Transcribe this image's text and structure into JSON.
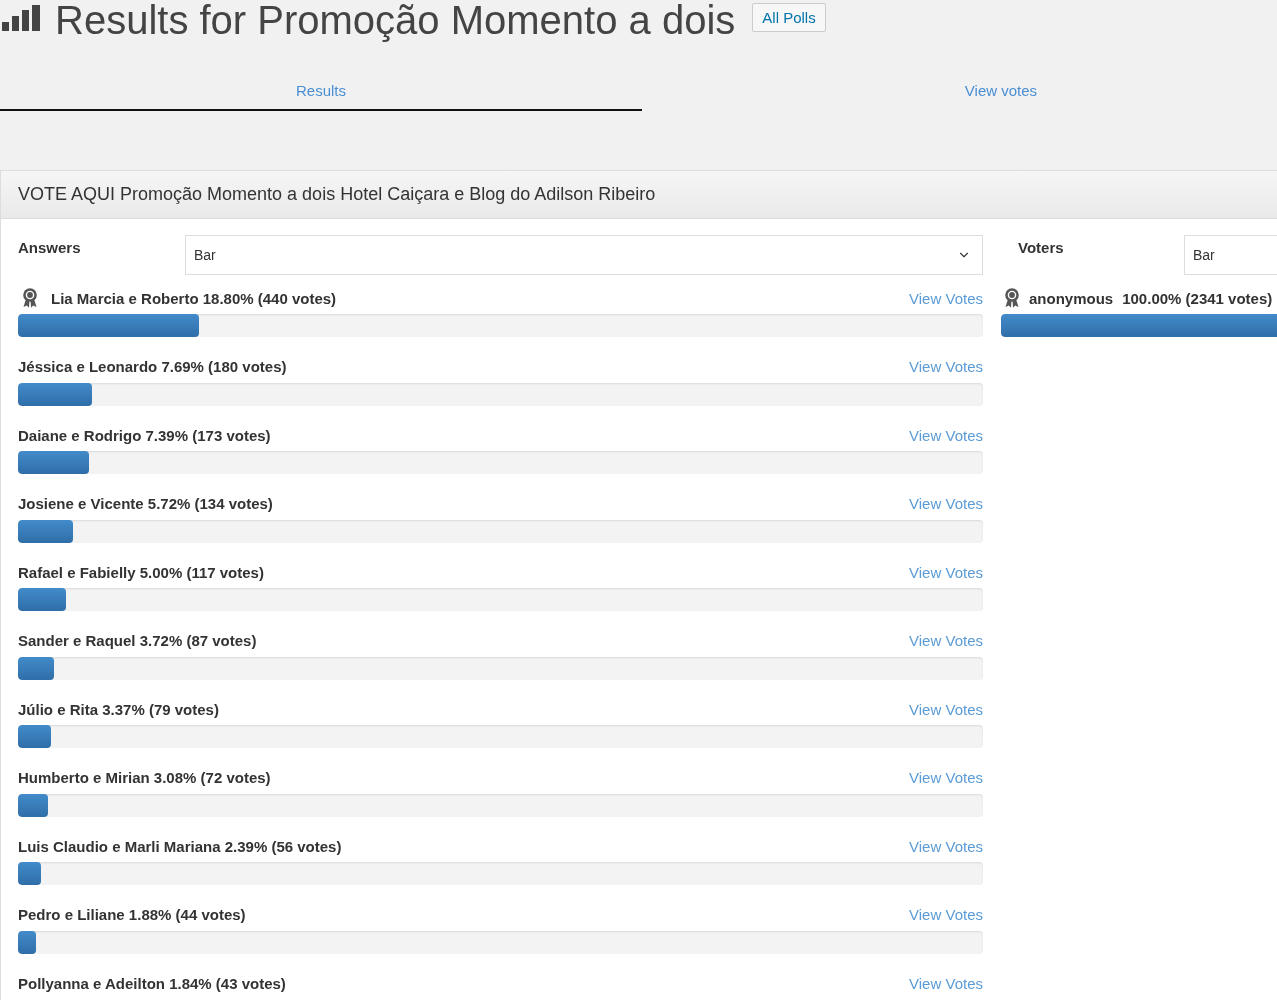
{
  "header": {
    "title": "Results for Promoção Momento a dois",
    "button": "All Polls"
  },
  "tabs": [
    {
      "label": "Results",
      "selected": true
    },
    {
      "label": "View votes",
      "selected": false
    }
  ],
  "poll": {
    "question": "VOTE AQUI Promoção Momento a dois Hotel Caiçara e Blog do Adilson Ribeiro",
    "answers": {
      "label": "Answers",
      "chart_type": "Bar",
      "items": [
        {
          "text": "Lia Marcia e Roberto 18.80% (440 votes)",
          "winner": true,
          "link": "View Votes",
          "level": 0.188
        },
        {
          "text": "Jéssica e Leonardo 7.69% (180 votes)",
          "winner": false,
          "link": "View Votes",
          "level": 0.0769
        },
        {
          "text": "Daiane e Rodrigo 7.39% (173 votes)",
          "winner": false,
          "link": "View Votes",
          "level": 0.0739
        },
        {
          "text": "Josiene e Vicente 5.72% (134 votes)",
          "winner": false,
          "link": "View Votes",
          "level": 0.0572
        },
        {
          "text": "Rafael e Fabielly 5.00% (117 votes)",
          "winner": false,
          "link": "View Votes",
          "level": 0.05
        },
        {
          "text": "Sander e Raquel 3.72% (87 votes)",
          "winner": false,
          "link": "View Votes",
          "level": 0.0372
        },
        {
          "text": "Júlio e Rita 3.37% (79 votes)",
          "winner": false,
          "link": "View Votes",
          "level": 0.0337
        },
        {
          "text": "Humberto e Mirian 3.08% (72 votes)",
          "winner": false,
          "link": "View Votes",
          "level": 0.0308
        },
        {
          "text": "Luis Claudio e Marli Mariana 2.39% (56 votes)",
          "winner": false,
          "link": "View Votes",
          "level": 0.0239
        },
        {
          "text": "Pedro e Liliane 1.88% (44 votes)",
          "winner": false,
          "link": "View Votes",
          "level": 0.0188
        },
        {
          "text": "Pollyanna e Adeilton 1.84% (43 votes)",
          "winner": false,
          "link": "View Votes"
        }
      ]
    },
    "voters": {
      "label": "Voters",
      "chart_type": "Bar",
      "items": [
        {
          "name": "anonymous",
          "stats": "100.00% (2341 votes)",
          "winner": true,
          "level": 1
        }
      ]
    }
  }
}
